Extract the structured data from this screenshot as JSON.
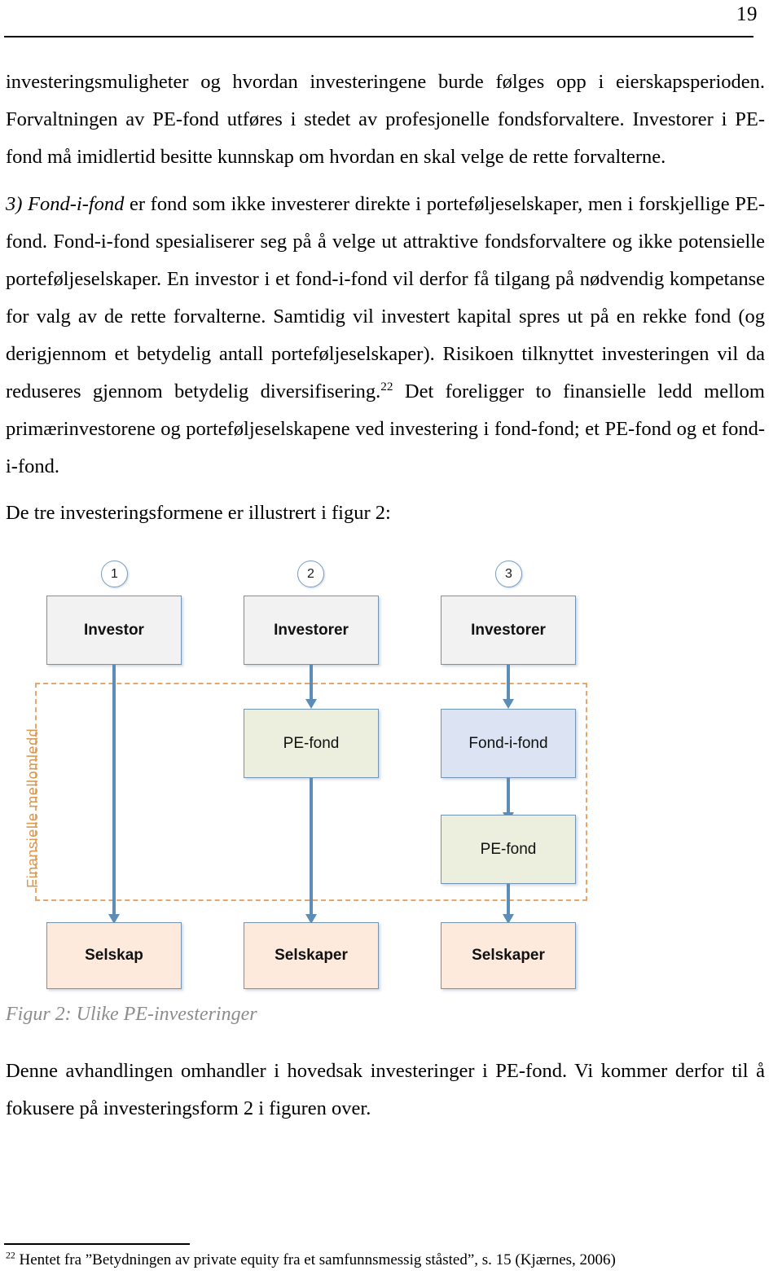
{
  "page": {
    "number": "19"
  },
  "paragraphs": {
    "p1": "investeringsmuligheter og hvordan investeringene burde følges opp i eierskapsperioden. Forvaltningen av PE-fond utføres i stedet av profesjonelle fondsforvaltere. Investorer i PE-fond må imidlertid besitte kunnskap om hvordan en skal velge de rette forvalterne.",
    "p2_lead_italic": "3) Fond-i-fond",
    "p2_rest_a": " er fond som ikke investerer direkte i porteføljeselskaper, men i forskjellige PE-fond. Fond-i-fond spesialiserer seg på å velge ut attraktive fondsforvaltere og ikke potensielle porteføljeselskaper. En investor i et fond-i-fond vil derfor få tilgang på nødvendig kompetanse for valg av de rette forvalterne. Samtidig vil investert kapital spres ut på en rekke fond (og derigjennom et betydelig antall porteføljeselskaper). Risikoen tilknyttet investeringen vil da reduseres gjennom betydelig diversifisering.",
    "p2_footnote_marker": "22",
    "p2_rest_b": " Det foreligger to finansielle ledd mellom primærinvestorene og porteføljeselskapene ved investering i fond-fond; et PE-fond og et fond-i-fond.",
    "p3": "De tre investeringsformene er illustrert i figur 2:",
    "p4": "Denne avhandlingen omhandler i hovedsak investeringer i PE-fond. Vi kommer derfor til å fokusere på investeringsform 2 i figuren over."
  },
  "figure": {
    "caption": "Figur 2: Ulike PE-investeringer",
    "vertical_label": "Finansielle mellomledd",
    "markers": [
      {
        "label": "1"
      },
      {
        "label": "2"
      },
      {
        "label": "3"
      }
    ],
    "columns": [
      {
        "marker": "1",
        "boxes": [
          {
            "label": "Investor",
            "kind": "investor"
          },
          {
            "label": "Selskap",
            "kind": "selskap"
          }
        ]
      },
      {
        "marker": "2",
        "boxes": [
          {
            "label": "Investorer",
            "kind": "investor"
          },
          {
            "label": "PE-fond",
            "kind": "pefond"
          },
          {
            "label": "Selskaper",
            "kind": "selskap"
          }
        ]
      },
      {
        "marker": "3",
        "boxes": [
          {
            "label": "Investorer",
            "kind": "investor"
          },
          {
            "label": "Fond-i-fond",
            "kind": "fondifond"
          },
          {
            "label": "PE-fond",
            "kind": "pefond"
          },
          {
            "label": "Selskaper",
            "kind": "selskap"
          }
        ]
      }
    ],
    "colors": {
      "investor_fill": "#f2f2f2",
      "pefond_fill": "#ecefdd",
      "fondifond_fill": "#dce3f2",
      "selskap_fill": "#fdeadd",
      "box_border": "#7194b5",
      "connector": "#5b8db8",
      "dashed_border": "#e8a76a",
      "vertical_label_color": "#d9974f",
      "caption_color": "#8c8c8c"
    }
  },
  "footnote": {
    "marker": "22",
    "text": "Hentet fra ”Betydningen av private equity fra et samfunnsmessig ståsted”, s. 15 (Kjærnes, 2006)"
  }
}
